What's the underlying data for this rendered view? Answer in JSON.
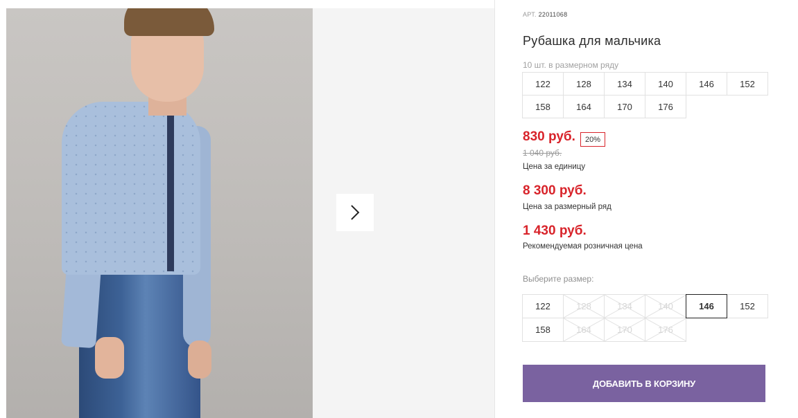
{
  "product": {
    "art_label": "АРТ.",
    "art_number": "22011068",
    "title": "Рубашка для мальчика",
    "pack_info": "10 шт. в размерном ряду",
    "pack_sizes": [
      "122",
      "128",
      "134",
      "140",
      "146",
      "152",
      "158",
      "164",
      "170",
      "176"
    ]
  },
  "pricing": {
    "unit_price": "830 руб.",
    "discount_badge": "20%",
    "old_price": "1 040 руб.",
    "unit_label": "Цена за единицу",
    "pack_price": "8 300 руб.",
    "pack_label": "Цена за размерный ряд",
    "retail_price": "1 430 руб.",
    "retail_label": "Рекомендуемая розничная цена"
  },
  "size_picker": {
    "label": "Выберите размер:",
    "sizes": [
      {
        "value": "122",
        "state": "available"
      },
      {
        "value": "128",
        "state": "unavailable"
      },
      {
        "value": "134",
        "state": "unavailable"
      },
      {
        "value": "140",
        "state": "unavailable"
      },
      {
        "value": "146",
        "state": "selected"
      },
      {
        "value": "152",
        "state": "available"
      },
      {
        "value": "158",
        "state": "available"
      },
      {
        "value": "164",
        "state": "unavailable"
      },
      {
        "value": "170",
        "state": "unavailable"
      },
      {
        "value": "176",
        "state": "unavailable"
      }
    ]
  },
  "actions": {
    "add_to_cart": "ДОБАВИТЬ В КОРЗИНУ"
  },
  "gallery": {
    "next_icon": "chevron-right-icon"
  },
  "colors": {
    "price_red": "#d8232a",
    "cart_button": "#7a62a0"
  }
}
